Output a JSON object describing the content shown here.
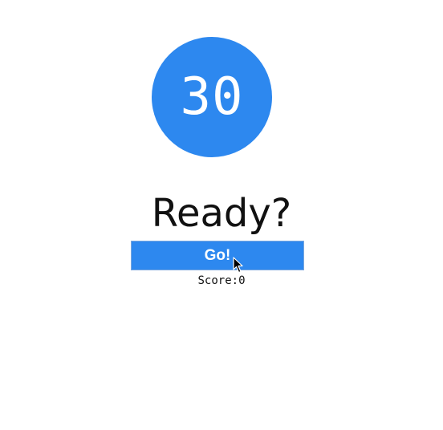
{
  "timer": {
    "value": "30"
  },
  "prompt": "Ready?",
  "go_button": {
    "label": "Go!"
  },
  "score": {
    "label": "Score:",
    "value": "0"
  },
  "colors": {
    "accent": "#2d88ef",
    "text": "#111111",
    "background": "#ffffff"
  },
  "icons": {
    "pointer": "mouse-pointer-icon"
  }
}
